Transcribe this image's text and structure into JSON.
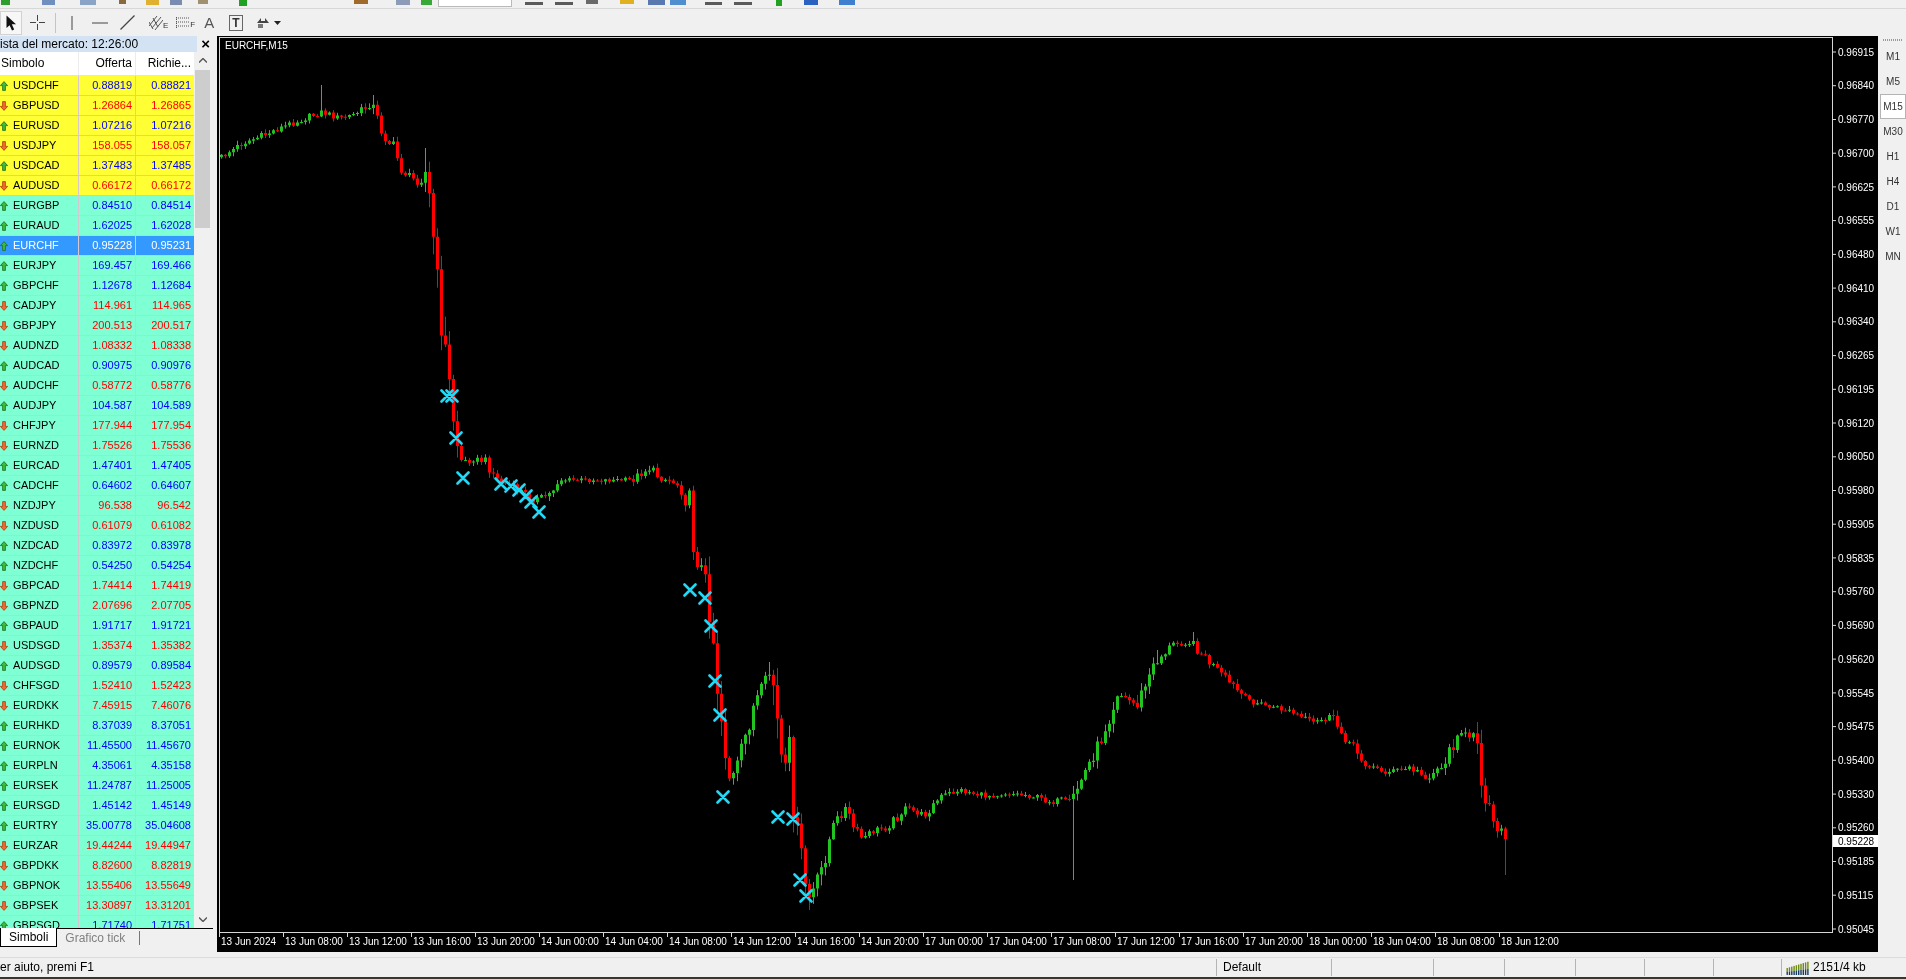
{
  "drawing_toolbar": {
    "cursor_active": true,
    "channel_letter": "E",
    "fibo_letter": "F",
    "text_tool": "A",
    "label_tool": "T"
  },
  "market_watch": {
    "title": "ista del mercato: 12:26:00",
    "close": "×",
    "columns": [
      "Simbolo",
      "Offerta",
      "Richie..."
    ],
    "rows": [
      {
        "symbol": "USDCHF",
        "bid": "0.88819",
        "ask": "0.88821",
        "rising": true,
        "color": "#ffff33",
        "selected": false
      },
      {
        "symbol": "GBPUSD",
        "bid": "1.26864",
        "ask": "1.26865",
        "rising": false,
        "color": "#ffff33",
        "selected": false
      },
      {
        "symbol": "EURUSD",
        "bid": "1.07216",
        "ask": "1.07216",
        "rising": true,
        "color": "#ffff33",
        "selected": false
      },
      {
        "symbol": "USDJPY",
        "bid": "158.055",
        "ask": "158.057",
        "rising": false,
        "color": "#ffff33",
        "selected": false
      },
      {
        "symbol": "USDCAD",
        "bid": "1.37483",
        "ask": "1.37485",
        "rising": true,
        "color": "#ffff33",
        "selected": false
      },
      {
        "symbol": "AUDUSD",
        "bid": "0.66172",
        "ask": "0.66172",
        "rising": false,
        "color": "#ffff33",
        "selected": false
      },
      {
        "symbol": "EURGBP",
        "bid": "0.84510",
        "ask": "0.84514",
        "rising": true,
        "color": "#7fffd4",
        "selected": false
      },
      {
        "symbol": "EURAUD",
        "bid": "1.62025",
        "ask": "1.62028",
        "rising": true,
        "color": "#7fffd4",
        "selected": false
      },
      {
        "symbol": "EURCHF",
        "bid": "0.95228",
        "ask": "0.95231",
        "rising": true,
        "selected": true
      },
      {
        "symbol": "EURJPY",
        "bid": "169.457",
        "ask": "169.466",
        "rising": true,
        "color": "#7fffd4",
        "selected": false
      },
      {
        "symbol": "GBPCHF",
        "bid": "1.12678",
        "ask": "1.12684",
        "rising": true,
        "color": "#7fffd4",
        "selected": false
      },
      {
        "symbol": "CADJPY",
        "bid": "114.961",
        "ask": "114.965",
        "rising": false,
        "color": "#7fffd4",
        "selected": false
      },
      {
        "symbol": "GBPJPY",
        "bid": "200.513",
        "ask": "200.517",
        "rising": false,
        "color": "#7fffd4",
        "selected": false
      },
      {
        "symbol": "AUDNZD",
        "bid": "1.08332",
        "ask": "1.08338",
        "rising": false,
        "color": "#7fffd4",
        "selected": false
      },
      {
        "symbol": "AUDCAD",
        "bid": "0.90975",
        "ask": "0.90976",
        "rising": true,
        "color": "#7fffd4",
        "selected": false
      },
      {
        "symbol": "AUDCHF",
        "bid": "0.58772",
        "ask": "0.58776",
        "rising": false,
        "color": "#7fffd4",
        "selected": false
      },
      {
        "symbol": "AUDJPY",
        "bid": "104.587",
        "ask": "104.589",
        "rising": true,
        "color": "#7fffd4",
        "selected": false
      },
      {
        "symbol": "CHFJPY",
        "bid": "177.944",
        "ask": "177.954",
        "rising": false,
        "color": "#7fffd4",
        "selected": false
      },
      {
        "symbol": "EURNZD",
        "bid": "1.75526",
        "ask": "1.75536",
        "rising": false,
        "color": "#7fffd4",
        "selected": false
      },
      {
        "symbol": "EURCAD",
        "bid": "1.47401",
        "ask": "1.47405",
        "rising": true,
        "color": "#7fffd4",
        "selected": false
      },
      {
        "symbol": "CADCHF",
        "bid": "0.64602",
        "ask": "0.64607",
        "rising": true,
        "color": "#7fffd4",
        "selected": false
      },
      {
        "symbol": "NZDJPY",
        "bid": "96.538",
        "ask": "96.542",
        "rising": false,
        "color": "#7fffd4",
        "selected": false
      },
      {
        "symbol": "NZDUSD",
        "bid": "0.61079",
        "ask": "0.61082",
        "rising": false,
        "color": "#7fffd4",
        "selected": false
      },
      {
        "symbol": "NZDCAD",
        "bid": "0.83972",
        "ask": "0.83978",
        "rising": true,
        "color": "#7fffd4",
        "selected": false
      },
      {
        "symbol": "NZDCHF",
        "bid": "0.54250",
        "ask": "0.54254",
        "rising": true,
        "color": "#7fffd4",
        "selected": false
      },
      {
        "symbol": "GBPCAD",
        "bid": "1.74414",
        "ask": "1.74419",
        "rising": false,
        "color": "#7fffd4",
        "selected": false
      },
      {
        "symbol": "GBPNZD",
        "bid": "2.07696",
        "ask": "2.07705",
        "rising": false,
        "color": "#7fffd4",
        "selected": false
      },
      {
        "symbol": "GBPAUD",
        "bid": "1.91717",
        "ask": "1.91721",
        "rising": true,
        "color": "#7fffd4",
        "selected": false
      },
      {
        "symbol": "USDSGD",
        "bid": "1.35374",
        "ask": "1.35382",
        "rising": false,
        "color": "#7fffd4",
        "selected": false
      },
      {
        "symbol": "AUDSGD",
        "bid": "0.89579",
        "ask": "0.89584",
        "rising": true,
        "color": "#7fffd4",
        "selected": false
      },
      {
        "symbol": "CHFSGD",
        "bid": "1.52410",
        "ask": "1.52423",
        "rising": false,
        "color": "#7fffd4",
        "selected": false
      },
      {
        "symbol": "EURDKK",
        "bid": "7.45915",
        "ask": "7.46076",
        "rising": false,
        "color": "#7fffd4",
        "selected": false
      },
      {
        "symbol": "EURHKD",
        "bid": "8.37039",
        "ask": "8.37051",
        "rising": true,
        "color": "#7fffd4",
        "selected": false
      },
      {
        "symbol": "EURNOK",
        "bid": "11.45500",
        "ask": "11.45670",
        "rising": true,
        "color": "#7fffd4",
        "selected": false
      },
      {
        "symbol": "EURPLN",
        "bid": "4.35061",
        "ask": "4.35158",
        "rising": true,
        "color": "#7fffd4",
        "selected": false
      },
      {
        "symbol": "EURSEK",
        "bid": "11.24787",
        "ask": "11.25005",
        "rising": true,
        "color": "#7fffd4",
        "selected": false
      },
      {
        "symbol": "EURSGD",
        "bid": "1.45142",
        "ask": "1.45149",
        "rising": true,
        "color": "#7fffd4",
        "selected": false
      },
      {
        "symbol": "EURTRY",
        "bid": "35.00778",
        "ask": "35.04608",
        "rising": true,
        "color": "#7fffd4",
        "selected": false
      },
      {
        "symbol": "EURZAR",
        "bid": "19.44244",
        "ask": "19.44947",
        "rising": false,
        "color": "#7fffd4",
        "selected": false
      },
      {
        "symbol": "GBPDKK",
        "bid": "8.82600",
        "ask": "8.82819",
        "rising": false,
        "color": "#7fffd4",
        "selected": false
      },
      {
        "symbol": "GBPNOK",
        "bid": "13.55406",
        "ask": "13.55649",
        "rising": false,
        "color": "#7fffd4",
        "selected": false
      },
      {
        "symbol": "GBPSEK",
        "bid": "13.30897",
        "ask": "13.31201",
        "rising": false,
        "color": "#7fffd4",
        "selected": false
      },
      {
        "symbol": "GBPSGD",
        "bid": "1.71740",
        "ask": "1.71751",
        "rising": true,
        "color": "#7fffd4",
        "selected": false
      }
    ],
    "tabs": [
      {
        "label": "Simboli",
        "selected": true
      },
      {
        "label": "Grafico tick",
        "selected": false
      }
    ]
  },
  "chart": {
    "title": "EURCHF,M15",
    "price_labels": [
      "0.96915",
      "0.96840",
      "0.96770",
      "0.96700",
      "0.96625",
      "0.96555",
      "0.96480",
      "0.96410",
      "0.96340",
      "0.96265",
      "0.96195",
      "0.96120",
      "0.96050",
      "0.95980",
      "0.95905",
      "0.95835",
      "0.95760",
      "0.95690",
      "0.95620",
      "0.95545",
      "0.95475",
      "0.95400",
      "0.95330",
      "0.95260",
      "0.95185",
      "0.95115",
      "0.95045"
    ],
    "current_price": "0.95228",
    "time_labels": [
      "13 Jun 2024",
      "13 Jun 08:00",
      "13 Jun 12:00",
      "13 Jun 16:00",
      "13 Jun 20:00",
      "14 Jun 00:00",
      "14 Jun 04:00",
      "14 Jun 08:00",
      "14 Jun 12:00",
      "14 Jun 16:00",
      "14 Jun 20:00",
      "17 Jun 00:00",
      "17 Jun 04:00",
      "17 Jun 08:00",
      "17 Jun 12:00",
      "17 Jun 16:00",
      "17 Jun 20:00",
      "18 Jun 00:00",
      "18 Jun 04:00",
      "18 Jun 08:00",
      "18 Jun 12:00"
    ]
  },
  "timeframes": [
    {
      "label": "M1",
      "selected": false
    },
    {
      "label": "M5",
      "selected": false
    },
    {
      "label": "M15",
      "selected": true
    },
    {
      "label": "M30",
      "selected": false
    },
    {
      "label": "H1",
      "selected": false
    },
    {
      "label": "H4",
      "selected": false
    },
    {
      "label": "D1",
      "selected": false
    },
    {
      "label": "W1",
      "selected": false
    },
    {
      "label": "MN",
      "selected": false
    }
  ],
  "status_bar": {
    "help": "er aiuto, premi F1",
    "profile": "Default",
    "traffic": "2151/4 kb"
  }
}
